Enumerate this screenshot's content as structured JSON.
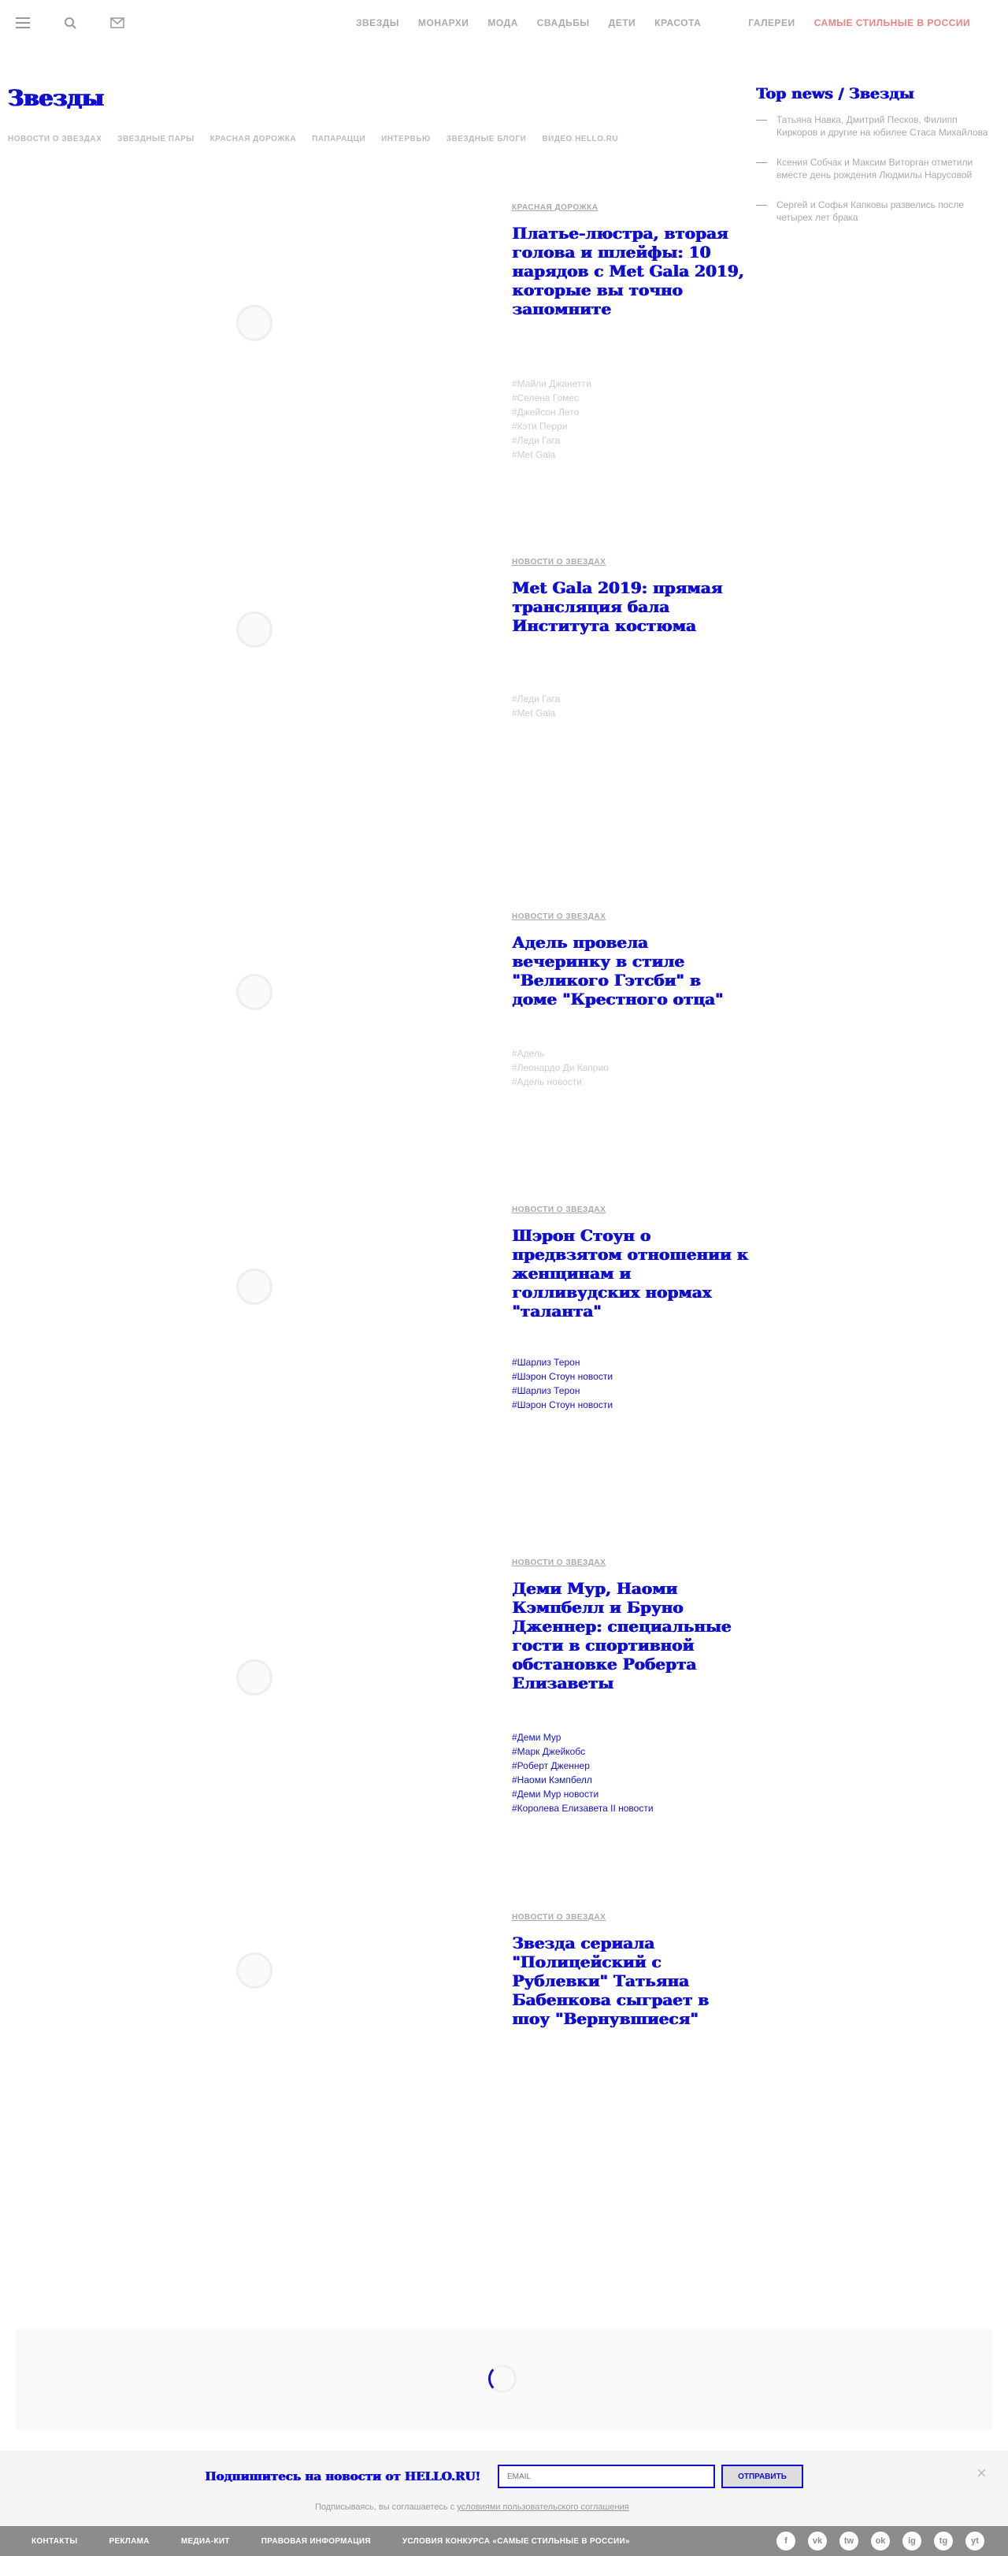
{
  "header": {
    "nav": [
      "Звезды",
      "Монархи",
      "Мода",
      "Свадьбы",
      "Дети",
      "Красота",
      "Галереи",
      "Самые стильные в России"
    ]
  },
  "page": {
    "title": "Звезды",
    "subnav": [
      "Новости о звездах",
      "Звездные пары",
      "Красная дорожка",
      "Папарацци",
      "Интервью",
      "Звездные блоги",
      "Видео Hello.ru"
    ]
  },
  "sidebar": {
    "title": "Top news / Звезды",
    "items": [
      "Татьяна Навка, Дмитрий Песков, Филипп Киркоров и другие на юбилее Стаса Михайлова",
      "Ксения Собчак и Максим Виторган отметили вместе день рождения Людмилы Нарусовой",
      "Сергей и Софья Капковы развелись после четырех лет брака"
    ]
  },
  "articles": [
    {
      "category": "Красная дорожка",
      "title": "Платье-люстра, вторая голова и шлейфы: 10 нарядов с Met Gala 2019, которые вы точно запомните",
      "tags": [
        "#Майли Джанетти",
        "#Селена Гомес",
        "#Джейсон Лето",
        "#Кэти Перри",
        "#Леди Гага",
        "#Met Gala"
      ]
    },
    {
      "category": "Новости о звездах",
      "title": "Met Gala 2019: прямая трансляция бала Института костюма",
      "tags": [
        "#Леди Гага",
        "#Met Gala"
      ]
    },
    {
      "category": "Новости о звездах",
      "title": "Адель провела вечеринку в стиле \"Великого Гэтсби\" в доме \"Крестного отца\"",
      "tags": [
        "#Адель",
        "#Леонардо Ди Каприо",
        "#Адель новости"
      ]
    },
    {
      "category": "Новости о звездах",
      "title": "Шэрон Стоун о предвзятом отношении к женщинам и голливудских нормах \"таланта\"",
      "tags": [
        "#Шарлиз Терон",
        "#Шэрон Стоун новости",
        "#Шарлиз Терон",
        "#Шэрон Стоун новости"
      ]
    },
    {
      "category": "Новости о звездах",
      "title": "Деми Мур, Наоми Кэмпбелл и Бруно Дженнер: специальные гости в спортивной обстановке Роберта Елизаветы",
      "tags": [
        "#Деми Мур",
        "#Марк Джейкобс",
        "#Роберт Дженнер",
        "#Наоми Кэмпбелл",
        "#Деми Мур новости",
        "#Королева Елизавета II новости"
      ]
    },
    {
      "category": "Новости о звездах",
      "title": "Звезда сериала \"Полицейский с Рублевки\" Татьяна Бабенкова сыграет в шоу \"Вернувшиеся\"",
      "tags": []
    }
  ],
  "newsletter": {
    "title": "Подпишитесь на новости от HELLO.RU!",
    "placeholder": "EMAIL",
    "button": "Отправить",
    "note_prefix": "Подписываясь, вы соглашаетесь с ",
    "note_link": "условиями пользовательского соглашения",
    "close": "×"
  },
  "footer": {
    "links": [
      "Контакты",
      "Реклама",
      "Медиа-кит",
      "Правовая информация",
      "Условия конкурса «Самые стильные в России»"
    ],
    "socials": [
      "f",
      "vk",
      "tw",
      "ok",
      "ig",
      "tg",
      "yt"
    ]
  }
}
